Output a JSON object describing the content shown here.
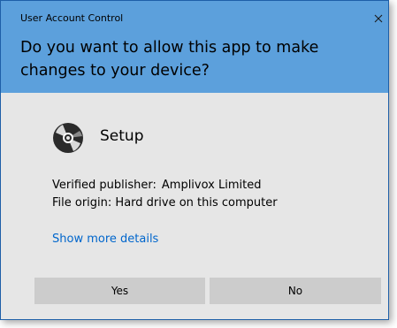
{
  "window": {
    "title": "User Account Control",
    "close_icon": "close-icon"
  },
  "header": {
    "question": "Do you want to allow this app to make changes to your device?",
    "background_color": "#5ca0dc"
  },
  "app": {
    "icon": "disc-icon",
    "name": "Setup"
  },
  "details": {
    "publisher_label": "Verified publisher:",
    "publisher_value": "Amplivox Limited",
    "origin_label": "File origin:",
    "origin_value": "Hard drive on this computer"
  },
  "link": {
    "label": "Show more details",
    "color": "#0066cc"
  },
  "buttons": {
    "yes": "Yes",
    "no": "No"
  }
}
